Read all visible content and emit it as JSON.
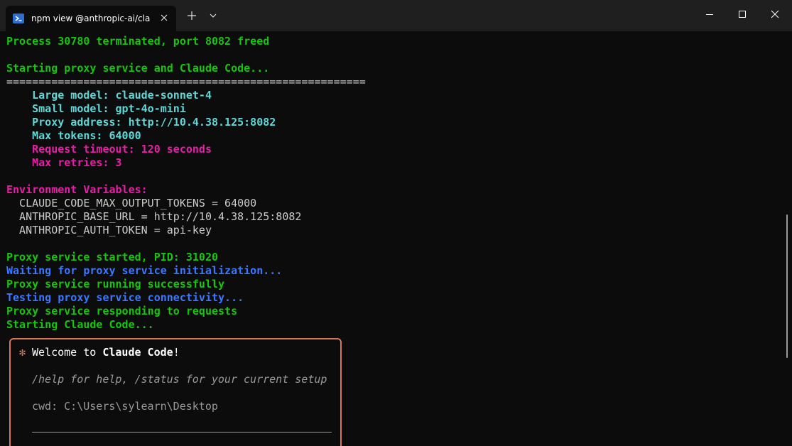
{
  "window": {
    "tab_title": "npm view @anthropic-ai/claude-code",
    "icons": {
      "tab": "powershell-icon",
      "tab_close": "close-icon",
      "new_tab": "plus-icon",
      "dropdown": "chevron-down-icon",
      "minimize": "minimize-icon",
      "maximize": "maximize-icon",
      "close": "close-icon"
    }
  },
  "terminal": {
    "lines": [
      {
        "text": "Process 30780 terminated, port 8082 freed",
        "color": "#16c60c"
      },
      {
        "text": "",
        "color": "#cccccc"
      },
      {
        "text": "Starting proxy service and Claude Code...",
        "color": "#16c60c"
      },
      {
        "text": "========================================================",
        "color": "#cccccc"
      },
      {
        "text": "    Large model: claude-sonnet-4",
        "color": "#61d6d6"
      },
      {
        "text": "    Small model: gpt-4o-mini",
        "color": "#61d6d6"
      },
      {
        "text": "    Proxy address: http://10.4.38.125:8082",
        "color": "#61d6d6"
      },
      {
        "text": "    Max tokens: 64000",
        "color": "#61d6d6"
      },
      {
        "text": "    Request timeout: 120 seconds",
        "color": "#e81ea8"
      },
      {
        "text": "    Max retries: 3",
        "color": "#e81ea8"
      },
      {
        "text": "",
        "color": "#cccccc"
      },
      {
        "text": "Environment Variables:",
        "color": "#e81ea8"
      },
      {
        "text": "  CLAUDE_CODE_MAX_OUTPUT_TOKENS = 64000",
        "color": "#cccccc"
      },
      {
        "text": "  ANTHROPIC_BASE_URL = http://10.4.38.125:8082",
        "color": "#cccccc"
      },
      {
        "text": "  ANTHROPIC_AUTH_TOKEN = api-key",
        "color": "#cccccc"
      },
      {
        "text": "",
        "color": "#cccccc"
      },
      {
        "text": "Proxy service started, PID: 31020",
        "color": "#16c60c"
      },
      {
        "text": "Waiting for proxy service initialization...",
        "color": "#3b78ff"
      },
      {
        "text": "Proxy service running successfully",
        "color": "#16c60c"
      },
      {
        "text": "Testing proxy service connectivity...",
        "color": "#3b78ff"
      },
      {
        "text": "Proxy service responding to requests",
        "color": "#16c60c"
      },
      {
        "text": "Starting Claude Code...",
        "color": "#16c60c"
      }
    ],
    "welcome": {
      "asterisk": "✻",
      "prefix": "Welcome to ",
      "app_name": "Claude Code",
      "suffix": "!",
      "hint": "/help for help, /status for your current setup",
      "cwd": "cwd: C:\\Users\\sylearn\\Desktop",
      "accent_color": "#d77757"
    }
  }
}
